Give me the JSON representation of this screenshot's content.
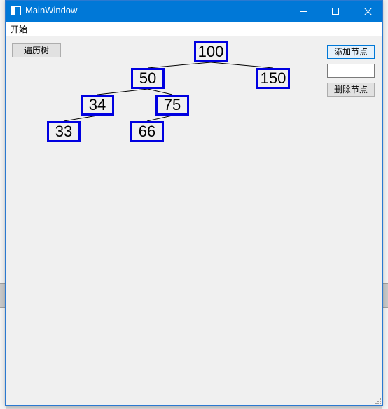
{
  "window": {
    "title": "MainWindow"
  },
  "menu": {
    "items": [
      "开始"
    ]
  },
  "toolbar": {
    "traverse_label": "遍历树",
    "add_label": "添加节点",
    "delete_label": "删除节点",
    "node_value_input": ""
  },
  "tree": {
    "nodes": [
      {
        "id": "n100",
        "value": "100"
      },
      {
        "id": "n50",
        "value": "50"
      },
      {
        "id": "n150",
        "value": "150"
      },
      {
        "id": "n34",
        "value": "34"
      },
      {
        "id": "n75",
        "value": "75"
      },
      {
        "id": "n33",
        "value": "33"
      },
      {
        "id": "n66",
        "value": "66"
      }
    ],
    "edges": [
      [
        "n100",
        "n50"
      ],
      [
        "n100",
        "n150"
      ],
      [
        "n50",
        "n34"
      ],
      [
        "n50",
        "n75"
      ],
      [
        "n34",
        "n33"
      ],
      [
        "n75",
        "n66"
      ]
    ],
    "node_border_color": "#0000e0"
  },
  "colors": {
    "titlebar": "#0078d7"
  }
}
